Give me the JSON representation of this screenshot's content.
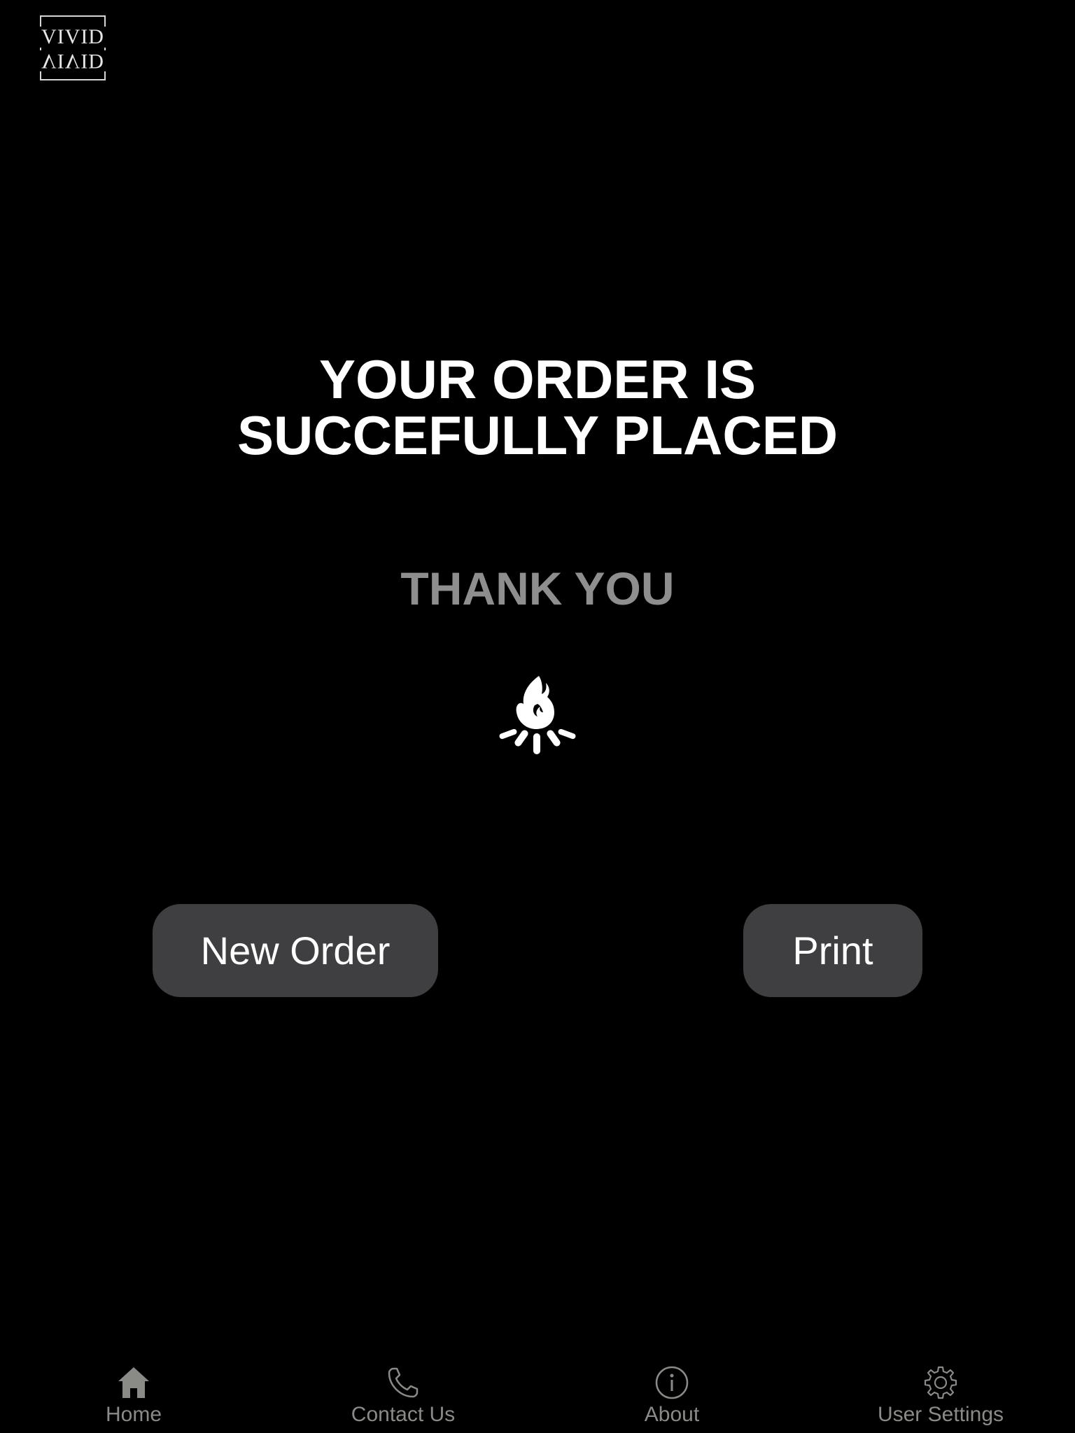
{
  "logo": {
    "top_text": "VIVID",
    "bottom_text": "VIVID"
  },
  "confirmation": {
    "title_line1": "YOUR ORDER IS",
    "title_line2": "SUCCEFULLY PLACED",
    "thanks": "THANK YOU",
    "icon": "bonfire-icon"
  },
  "actions": {
    "new_order_label": "New Order",
    "print_label": "Print"
  },
  "bottom_nav": {
    "items": [
      {
        "label": "Home",
        "icon": "home-icon",
        "active": true
      },
      {
        "label": "Contact Us",
        "icon": "phone-icon",
        "active": false
      },
      {
        "label": "About",
        "icon": "info-icon",
        "active": false
      },
      {
        "label": "User Settings",
        "icon": "gear-icon",
        "active": false
      }
    ]
  },
  "colors": {
    "background": "#000000",
    "title": "#ffffff",
    "thanks": "#8e8e8e",
    "button_bg": "#3f3f41",
    "nav_text": "#8a8a86"
  }
}
